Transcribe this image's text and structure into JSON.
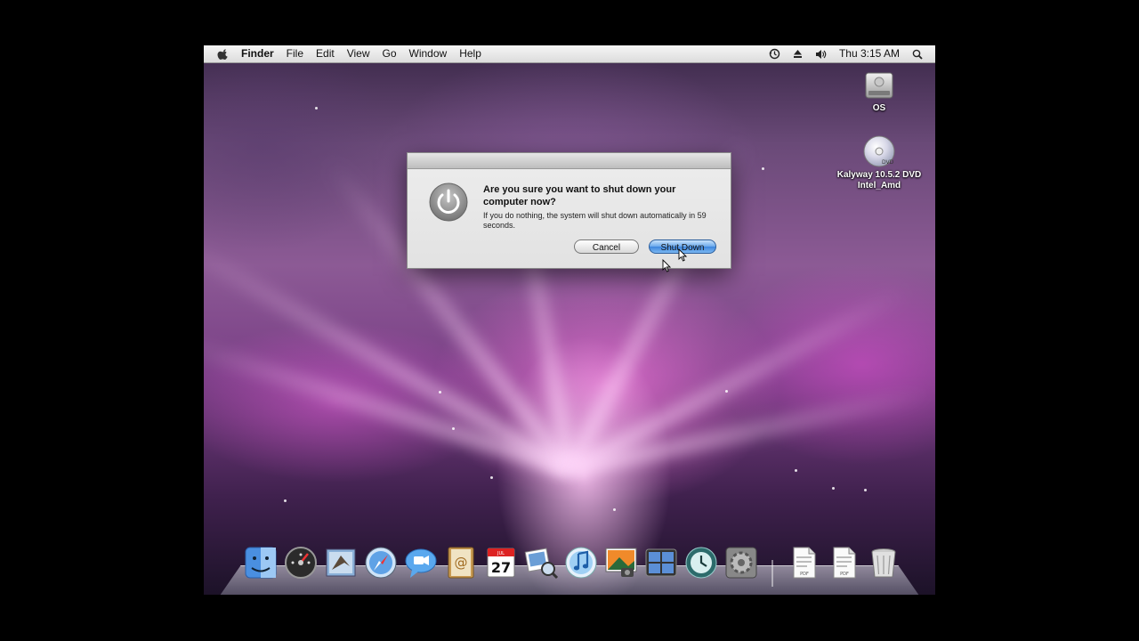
{
  "menubar": {
    "app_name": "Finder",
    "menus": [
      "File",
      "Edit",
      "View",
      "Go",
      "Window",
      "Help"
    ],
    "clock": "Thu 3:15 AM",
    "status_icons": [
      "time-machine-icon",
      "eject-icon",
      "volume-icon",
      "spotlight-icon"
    ]
  },
  "desktop": {
    "icons": [
      {
        "label": "OS",
        "icon": "hard-drive-icon"
      },
      {
        "label_line1": "Kalyway 10.5.2 DVD",
        "label_line2": "Intel_Amd",
        "icon": "dvd-disc-icon"
      }
    ]
  },
  "dialog": {
    "heading": "Are you sure you want to shut down your computer now?",
    "message": "If you do nothing, the system will shut down automatically in 59 seconds.",
    "cancel_label": "Cancel",
    "confirm_label": "Shut Down",
    "icon": "power-icon"
  },
  "dock": {
    "items": [
      "finder-icon",
      "dashboard-icon",
      "mail-icon",
      "safari-icon",
      "ichat-icon",
      "address-book-icon",
      "ical-icon",
      "preview-icon",
      "itunes-icon",
      "iphoto-icon",
      "spaces-icon",
      "time-machine-icon",
      "system-preferences-icon",
      "pdf-document-icon",
      "pdf-document-icon",
      "trash-icon"
    ],
    "calendar_month": "JUL",
    "calendar_day": "27",
    "pdf_label": "PDF"
  },
  "colors": {
    "default_button": "#3d86de",
    "menubar": "#e4e4e4",
    "wallpaper_accent": "#e070d8"
  }
}
